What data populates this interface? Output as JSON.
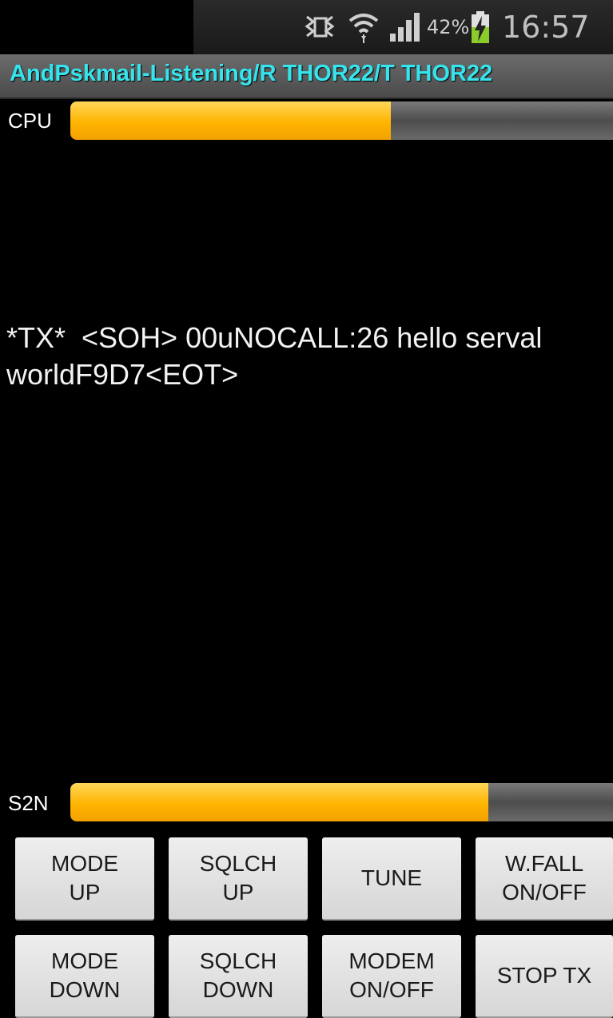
{
  "status_bar": {
    "battery_percent": "42%",
    "time": "16:57",
    "icons": [
      "nfc-icon",
      "wifi-icon",
      "signal-icon",
      "battery-charging-icon"
    ]
  },
  "title": "AndPskmail-Listening/R THOR22/T THOR22",
  "cpu_meter": {
    "label": "CPU",
    "level_percent": 59
  },
  "s2n_meter": {
    "label": "S2N",
    "level_percent": 77
  },
  "received_text": "*TX*  <SOH> 00uNOCALL:26 hello serval worldF9D7<EOT>",
  "buttons": {
    "mode_up": "MODE\nUP",
    "sqlch_up": "SQLCH\nUP",
    "tune": "TUNE",
    "wfall": "W.FALL\nON/OFF",
    "mode_down": "MODE\nDOWN",
    "sqlch_down": "SQLCH\nDOWN",
    "modem": "MODEM\nON/OFF",
    "stop_tx": "STOP TX"
  },
  "colors": {
    "title_text": "#35e4ec",
    "meter_fill": "#ffb400",
    "background": "#000000"
  }
}
